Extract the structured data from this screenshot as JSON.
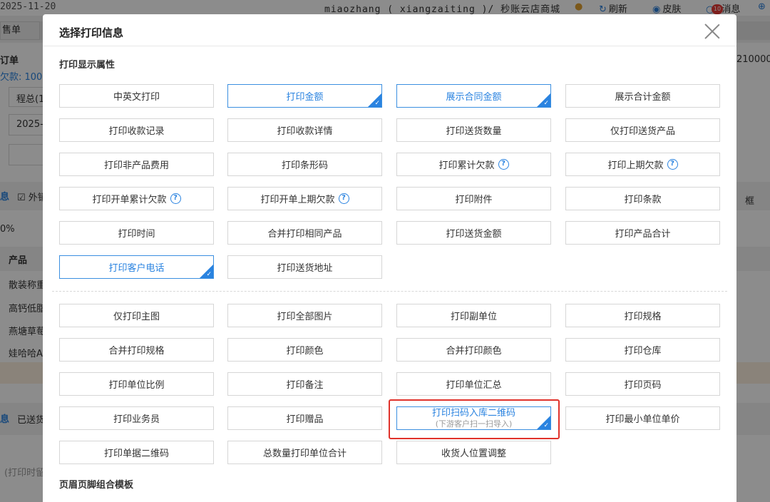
{
  "background": {
    "date": "2025-11-20",
    "shop": "miaozhang ( xiangzaiting )/ 秒账云店商城",
    "refresh": "刷新",
    "skin": "皮肤",
    "message": "消息",
    "message_badge": "10",
    "tab": "售单",
    "left_labels": [
      "订单",
      "欠款: 100",
      "程总(1",
      "2025-",
      "息",
      "外销",
      "0%",
      "产品",
      "散装称重",
      "高钙低脂",
      "燕塘草莓",
      "娃哈哈A",
      "息",
      "已送货",
      "(打印时留"
    ],
    "right_labels": [
      "210000",
      "框"
    ]
  },
  "dialog": {
    "title": "选择打印信息",
    "section1_title": "打印显示属性",
    "section2_title": "页眉页脚组合模板",
    "group1": [
      {
        "label": "中英文打印",
        "selected": false
      },
      {
        "label": "打印金额",
        "selected": true
      },
      {
        "label": "展示合同金额",
        "selected": true
      },
      {
        "label": "展示合计金额",
        "selected": false
      },
      {
        "label": "打印收款记录",
        "selected": false
      },
      {
        "label": "打印收款详情",
        "selected": false
      },
      {
        "label": "打印送货数量",
        "selected": false
      },
      {
        "label": "仅打印送货产品",
        "selected": false
      },
      {
        "label": "打印非产品费用",
        "selected": false
      },
      {
        "label": "打印条形码",
        "selected": false
      },
      {
        "label": "打印累计欠款",
        "selected": false,
        "help": true
      },
      {
        "label": "打印上期欠款",
        "selected": false,
        "help": true
      },
      {
        "label": "打印开单累计欠款",
        "selected": false,
        "help": true
      },
      {
        "label": "打印开单上期欠款",
        "selected": false,
        "help": true
      },
      {
        "label": "打印附件",
        "selected": false
      },
      {
        "label": "打印条款",
        "selected": false
      },
      {
        "label": "打印时间",
        "selected": false
      },
      {
        "label": "合并打印相同产品",
        "selected": false
      },
      {
        "label": "打印送货金额",
        "selected": false
      },
      {
        "label": "打印产品合计",
        "selected": false
      },
      {
        "label": "打印客户电话",
        "selected": true
      },
      {
        "label": "打印送货地址",
        "selected": false
      }
    ],
    "group2": [
      {
        "label": "仅打印主图",
        "selected": false
      },
      {
        "label": "打印全部图片",
        "selected": false
      },
      {
        "label": "打印副单位",
        "selected": false
      },
      {
        "label": "打印规格",
        "selected": false
      },
      {
        "label": "合并打印规格",
        "selected": false
      },
      {
        "label": "打印颜色",
        "selected": false
      },
      {
        "label": "合并打印颜色",
        "selected": false
      },
      {
        "label": "打印仓库",
        "selected": false
      },
      {
        "label": "打印单位比例",
        "selected": false
      },
      {
        "label": "打印备注",
        "selected": false
      },
      {
        "label": "打印单位汇总",
        "selected": false
      },
      {
        "label": "打印页码",
        "selected": false
      },
      {
        "label": "打印业务员",
        "selected": false
      },
      {
        "label": "打印赠品",
        "selected": false
      },
      {
        "label": "打印扫码入库二维码",
        "sublabel": "(下游客户扫一扫导入)",
        "selected": true
      },
      {
        "label": "打印最小单位单价",
        "selected": false
      },
      {
        "label": "打印单据二维码",
        "selected": false
      },
      {
        "label": "总数量打印单位合计",
        "selected": false
      },
      {
        "label": "收货人位置调整",
        "selected": false
      }
    ],
    "help_glyph": "?",
    "check_glyph": "✓"
  }
}
